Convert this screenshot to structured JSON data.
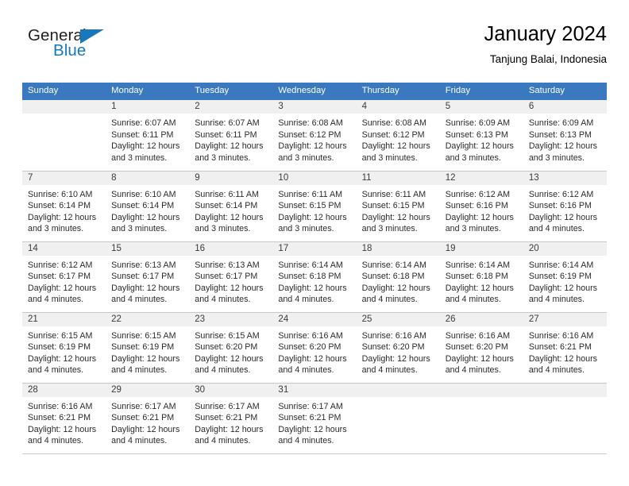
{
  "brand": {
    "name_part1": "General",
    "name_part2": "Blue",
    "triangle_icon": "blue-triangle-icon",
    "color_dark": "#231f20",
    "color_blue": "#1878be"
  },
  "header": {
    "title": "January 2024",
    "subtitle": "Tanjung Balai, Indonesia"
  },
  "calendar": {
    "header_bg": "#3a78bf",
    "daynum_bg": "#f0f0f0",
    "weekday_headers": [
      "Sunday",
      "Monday",
      "Tuesday",
      "Wednesday",
      "Thursday",
      "Friday",
      "Saturday"
    ],
    "weeks": [
      [
        {
          "day": "",
          "blank": true,
          "sunrise": "",
          "sunset": "",
          "daylight_line1": "",
          "daylight_line2": ""
        },
        {
          "day": "1",
          "sunrise": "Sunrise: 6:07 AM",
          "sunset": "Sunset: 6:11 PM",
          "daylight_line1": "Daylight: 12 hours",
          "daylight_line2": "and 3 minutes."
        },
        {
          "day": "2",
          "sunrise": "Sunrise: 6:07 AM",
          "sunset": "Sunset: 6:11 PM",
          "daylight_line1": "Daylight: 12 hours",
          "daylight_line2": "and 3 minutes."
        },
        {
          "day": "3",
          "sunrise": "Sunrise: 6:08 AM",
          "sunset": "Sunset: 6:12 PM",
          "daylight_line1": "Daylight: 12 hours",
          "daylight_line2": "and 3 minutes."
        },
        {
          "day": "4",
          "sunrise": "Sunrise: 6:08 AM",
          "sunset": "Sunset: 6:12 PM",
          "daylight_line1": "Daylight: 12 hours",
          "daylight_line2": "and 3 minutes."
        },
        {
          "day": "5",
          "sunrise": "Sunrise: 6:09 AM",
          "sunset": "Sunset: 6:13 PM",
          "daylight_line1": "Daylight: 12 hours",
          "daylight_line2": "and 3 minutes."
        },
        {
          "day": "6",
          "sunrise": "Sunrise: 6:09 AM",
          "sunset": "Sunset: 6:13 PM",
          "daylight_line1": "Daylight: 12 hours",
          "daylight_line2": "and 3 minutes."
        }
      ],
      [
        {
          "day": "7",
          "sunrise": "Sunrise: 6:10 AM",
          "sunset": "Sunset: 6:14 PM",
          "daylight_line1": "Daylight: 12 hours",
          "daylight_line2": "and 3 minutes."
        },
        {
          "day": "8",
          "sunrise": "Sunrise: 6:10 AM",
          "sunset": "Sunset: 6:14 PM",
          "daylight_line1": "Daylight: 12 hours",
          "daylight_line2": "and 3 minutes."
        },
        {
          "day": "9",
          "sunrise": "Sunrise: 6:11 AM",
          "sunset": "Sunset: 6:14 PM",
          "daylight_line1": "Daylight: 12 hours",
          "daylight_line2": "and 3 minutes."
        },
        {
          "day": "10",
          "sunrise": "Sunrise: 6:11 AM",
          "sunset": "Sunset: 6:15 PM",
          "daylight_line1": "Daylight: 12 hours",
          "daylight_line2": "and 3 minutes."
        },
        {
          "day": "11",
          "sunrise": "Sunrise: 6:11 AM",
          "sunset": "Sunset: 6:15 PM",
          "daylight_line1": "Daylight: 12 hours",
          "daylight_line2": "and 3 minutes."
        },
        {
          "day": "12",
          "sunrise": "Sunrise: 6:12 AM",
          "sunset": "Sunset: 6:16 PM",
          "daylight_line1": "Daylight: 12 hours",
          "daylight_line2": "and 3 minutes."
        },
        {
          "day": "13",
          "sunrise": "Sunrise: 6:12 AM",
          "sunset": "Sunset: 6:16 PM",
          "daylight_line1": "Daylight: 12 hours",
          "daylight_line2": "and 4 minutes."
        }
      ],
      [
        {
          "day": "14",
          "sunrise": "Sunrise: 6:12 AM",
          "sunset": "Sunset: 6:17 PM",
          "daylight_line1": "Daylight: 12 hours",
          "daylight_line2": "and 4 minutes."
        },
        {
          "day": "15",
          "sunrise": "Sunrise: 6:13 AM",
          "sunset": "Sunset: 6:17 PM",
          "daylight_line1": "Daylight: 12 hours",
          "daylight_line2": "and 4 minutes."
        },
        {
          "day": "16",
          "sunrise": "Sunrise: 6:13 AM",
          "sunset": "Sunset: 6:17 PM",
          "daylight_line1": "Daylight: 12 hours",
          "daylight_line2": "and 4 minutes."
        },
        {
          "day": "17",
          "sunrise": "Sunrise: 6:14 AM",
          "sunset": "Sunset: 6:18 PM",
          "daylight_line1": "Daylight: 12 hours",
          "daylight_line2": "and 4 minutes."
        },
        {
          "day": "18",
          "sunrise": "Sunrise: 6:14 AM",
          "sunset": "Sunset: 6:18 PM",
          "daylight_line1": "Daylight: 12 hours",
          "daylight_line2": "and 4 minutes."
        },
        {
          "day": "19",
          "sunrise": "Sunrise: 6:14 AM",
          "sunset": "Sunset: 6:18 PM",
          "daylight_line1": "Daylight: 12 hours",
          "daylight_line2": "and 4 minutes."
        },
        {
          "day": "20",
          "sunrise": "Sunrise: 6:14 AM",
          "sunset": "Sunset: 6:19 PM",
          "daylight_line1": "Daylight: 12 hours",
          "daylight_line2": "and 4 minutes."
        }
      ],
      [
        {
          "day": "21",
          "sunrise": "Sunrise: 6:15 AM",
          "sunset": "Sunset: 6:19 PM",
          "daylight_line1": "Daylight: 12 hours",
          "daylight_line2": "and 4 minutes."
        },
        {
          "day": "22",
          "sunrise": "Sunrise: 6:15 AM",
          "sunset": "Sunset: 6:19 PM",
          "daylight_line1": "Daylight: 12 hours",
          "daylight_line2": "and 4 minutes."
        },
        {
          "day": "23",
          "sunrise": "Sunrise: 6:15 AM",
          "sunset": "Sunset: 6:20 PM",
          "daylight_line1": "Daylight: 12 hours",
          "daylight_line2": "and 4 minutes."
        },
        {
          "day": "24",
          "sunrise": "Sunrise: 6:16 AM",
          "sunset": "Sunset: 6:20 PM",
          "daylight_line1": "Daylight: 12 hours",
          "daylight_line2": "and 4 minutes."
        },
        {
          "day": "25",
          "sunrise": "Sunrise: 6:16 AM",
          "sunset": "Sunset: 6:20 PM",
          "daylight_line1": "Daylight: 12 hours",
          "daylight_line2": "and 4 minutes."
        },
        {
          "day": "26",
          "sunrise": "Sunrise: 6:16 AM",
          "sunset": "Sunset: 6:20 PM",
          "daylight_line1": "Daylight: 12 hours",
          "daylight_line2": "and 4 minutes."
        },
        {
          "day": "27",
          "sunrise": "Sunrise: 6:16 AM",
          "sunset": "Sunset: 6:21 PM",
          "daylight_line1": "Daylight: 12 hours",
          "daylight_line2": "and 4 minutes."
        }
      ],
      [
        {
          "day": "28",
          "sunrise": "Sunrise: 6:16 AM",
          "sunset": "Sunset: 6:21 PM",
          "daylight_line1": "Daylight: 12 hours",
          "daylight_line2": "and 4 minutes."
        },
        {
          "day": "29",
          "sunrise": "Sunrise: 6:17 AM",
          "sunset": "Sunset: 6:21 PM",
          "daylight_line1": "Daylight: 12 hours",
          "daylight_line2": "and 4 minutes."
        },
        {
          "day": "30",
          "sunrise": "Sunrise: 6:17 AM",
          "sunset": "Sunset: 6:21 PM",
          "daylight_line1": "Daylight: 12 hours",
          "daylight_line2": "and 4 minutes."
        },
        {
          "day": "31",
          "sunrise": "Sunrise: 6:17 AM",
          "sunset": "Sunset: 6:21 PM",
          "daylight_line1": "Daylight: 12 hours",
          "daylight_line2": "and 4 minutes."
        },
        {
          "day": "",
          "blank": true,
          "sunrise": "",
          "sunset": "",
          "daylight_line1": "",
          "daylight_line2": ""
        },
        {
          "day": "",
          "blank": true,
          "sunrise": "",
          "sunset": "",
          "daylight_line1": "",
          "daylight_line2": ""
        },
        {
          "day": "",
          "blank": true,
          "sunrise": "",
          "sunset": "",
          "daylight_line1": "",
          "daylight_line2": ""
        }
      ]
    ]
  }
}
